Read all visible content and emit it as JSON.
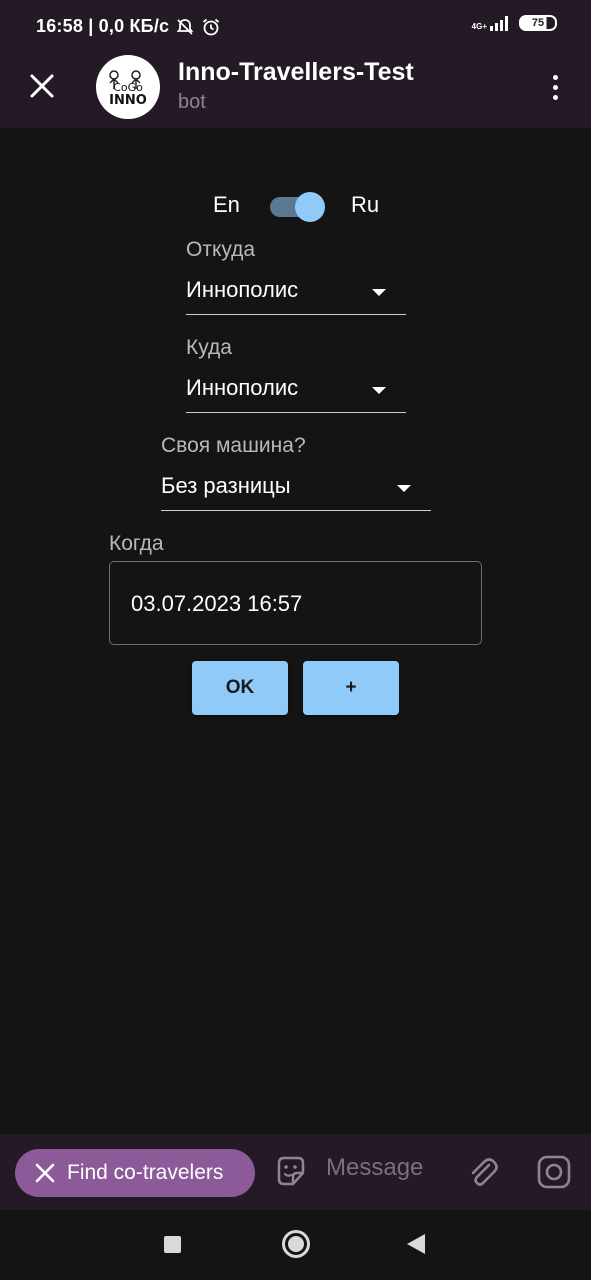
{
  "status_bar": {
    "time_net": "16:58 | 0,0 КБ/с",
    "network": "4G+",
    "battery": "75",
    "icons": [
      "bell-off-icon",
      "alarm-icon",
      "signal-icon",
      "battery-icon"
    ]
  },
  "header": {
    "title": "Inno-Travellers-Test",
    "subtitle": "bot",
    "avatar_text_top": "CoGo",
    "avatar_text_bottom": "INNO"
  },
  "form": {
    "lang_left": "En",
    "lang_right": "Ru",
    "lang_toggle_on": true,
    "from_label": "Откуда",
    "from_value": "Иннополис",
    "to_label": "Куда",
    "to_value": "Иннополис",
    "car_label": "Своя машина?",
    "car_value": "Без разницы",
    "when_label": "Когда",
    "when_value": "03.07.2023 16:57",
    "ok_button": "OK",
    "plus_button": "+"
  },
  "input_bar": {
    "chip_label": "Find co-travelers",
    "message_placeholder": "Message"
  },
  "colors": {
    "bar_bg": "#231a25",
    "page_bg": "#141414",
    "accent": "#90caf9",
    "chip": "#8d5a99"
  }
}
